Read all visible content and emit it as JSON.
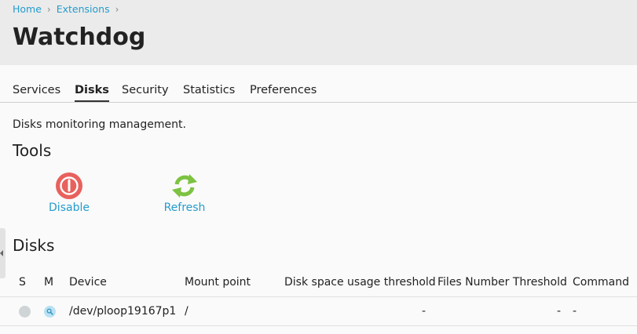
{
  "breadcrumb": {
    "items": [
      "Home",
      "Extensions"
    ]
  },
  "page": {
    "title": "Watchdog",
    "description": "Disks monitoring management."
  },
  "tabs": [
    {
      "label": "Services",
      "active": false
    },
    {
      "label": "Disks",
      "active": true
    },
    {
      "label": "Security",
      "active": false
    },
    {
      "label": "Statistics",
      "active": false
    },
    {
      "label": "Preferences",
      "active": false
    }
  ],
  "tools": {
    "title": "Tools",
    "items": [
      {
        "label": "Disable",
        "icon": "power-off-icon",
        "color": "#e8615d"
      },
      {
        "label": "Refresh",
        "icon": "refresh-icon",
        "color": "#7dc242"
      }
    ]
  },
  "disks": {
    "title": "Disks",
    "columns": [
      "S",
      "M",
      "Device",
      "Mount point",
      "Disk space usage threshold",
      "Files Number Threshold",
      "Command"
    ],
    "rows": [
      {
        "status_icon": "status-inactive-icon",
        "monitor_icon": "magnifier-icon",
        "device": "/dev/ploop19167p1",
        "mount_point": "/",
        "disk_space_threshold": "-",
        "files_number_threshold": "-",
        "command": "-"
      }
    ]
  },
  "colors": {
    "link": "#259ccc",
    "header_bg": "#ebebeb",
    "page_bg": "#fafafa"
  }
}
